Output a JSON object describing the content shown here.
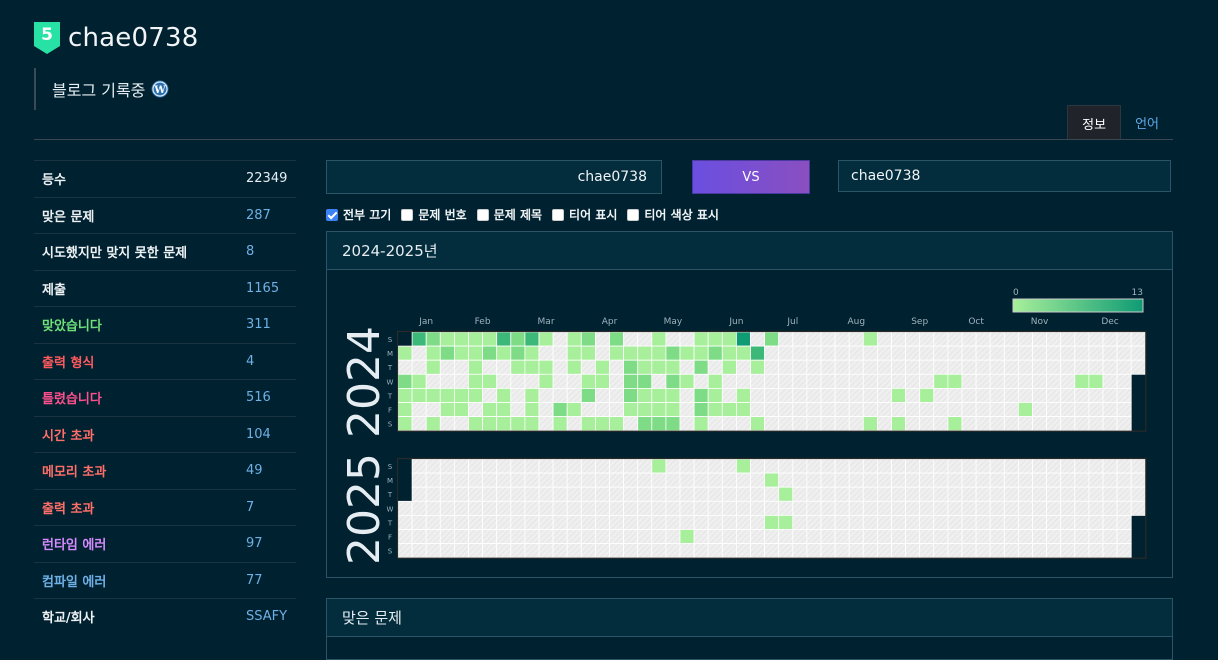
{
  "profile": {
    "tier_number": "5",
    "username": "chae0738",
    "bio": "블로그 기록중"
  },
  "tabs": [
    {
      "label": "정보",
      "active": true
    },
    {
      "label": "언어",
      "active": false
    }
  ],
  "stats": [
    {
      "label": "등수",
      "value": "22349",
      "color": "white"
    },
    {
      "label": "맞은 문제",
      "value": "287",
      "color": "white"
    },
    {
      "label": "시도했지만 맞지 못한 문제",
      "value": "8",
      "color": "white"
    },
    {
      "label": "제출",
      "value": "1165",
      "color": "white"
    },
    {
      "label": "맞았습니다",
      "value": "311",
      "color": "green"
    },
    {
      "label": "출력 형식",
      "value": "4",
      "color": "red"
    },
    {
      "label": "틀렸습니다",
      "value": "516",
      "color": "pink"
    },
    {
      "label": "시간 초과",
      "value": "104",
      "color": "orange"
    },
    {
      "label": "메모리 초과",
      "value": "49",
      "color": "orange"
    },
    {
      "label": "출력 초과",
      "value": "7",
      "color": "orange"
    },
    {
      "label": "런타임 에러",
      "value": "97",
      "color": "purple"
    },
    {
      "label": "컴파일 에러",
      "value": "77",
      "color": "blue"
    },
    {
      "label": "학교/회사",
      "value": "SSAFY",
      "color": "white"
    }
  ],
  "compare": {
    "left_user": "chae0738",
    "vs_label": "VS",
    "right_user": "chae0738"
  },
  "options": [
    {
      "label": "전부 끄기",
      "checked": true
    },
    {
      "label": "문제 번호",
      "checked": false
    },
    {
      "label": "문제 제목",
      "checked": false
    },
    {
      "label": "티어 표시",
      "checked": false
    },
    {
      "label": "티어 색상 표시",
      "checked": false
    }
  ],
  "heatmap_panel": {
    "title": "2024-2025년",
    "legend_min": "0",
    "legend_max": "13",
    "legend_color_low": "#a7ef9a",
    "legend_color_high": "#0f9b74",
    "months": [
      "Jan",
      "Feb",
      "Mar",
      "Apr",
      "May",
      "Jun",
      "Jul",
      "Aug",
      "Sep",
      "Oct",
      "Nov",
      "Dec"
    ],
    "weekdays": [
      "S",
      "M",
      "T",
      "W",
      "T",
      "F",
      "S"
    ],
    "years": [
      "2024",
      "2025"
    ]
  },
  "solved_panel": {
    "title": "맞은 문제"
  }
}
